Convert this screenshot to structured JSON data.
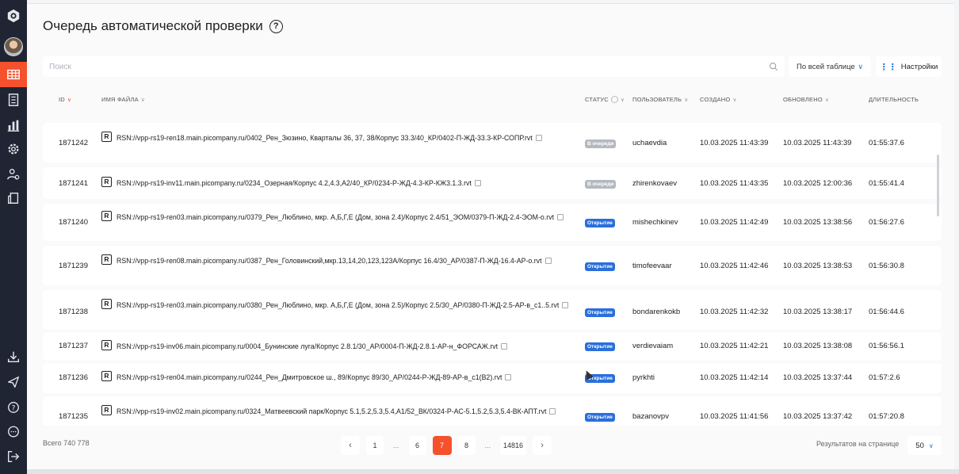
{
  "page": {
    "title": "Очередь автоматической проверки",
    "help_icon": "?"
  },
  "toolbar": {
    "search_placeholder": "Поиск",
    "scope_select": "По всей таблице",
    "settings_label": "Настройки"
  },
  "table": {
    "headers": {
      "id": "ID",
      "file": "Имя файла",
      "status": "Статус",
      "user": "Пользователь",
      "created": "Создано",
      "updated": "Обновлено",
      "duration": "Длительность"
    },
    "rows": [
      {
        "id": "1871242",
        "file": "RSN://vpp-rs19-ren18.main.picompany.ru/0402_Рен_Зюзино, Кварталы 36, 37, 38/Корпус 33.3/40_КР/0402-П-ЖД-33.3-КР-СОПР.rvt",
        "status": "В очереди",
        "status_type": "queue",
        "user": "uchaevdia",
        "created": "10.03.2025 11:43:39",
        "updated": "10.03.2025 11:43:39",
        "duration": "01:55:37.6"
      },
      {
        "id": "1871241",
        "file": "RSN://vpp-rs19-inv11.main.picompany.ru/0234_Озерная/Корпус 4.2,4.3,A2/40_КР/0234-Р-ЖД-4.3-КР-КЖ3.1.3.rvt",
        "status": "В очереди",
        "status_type": "queue",
        "user": "zhirenkovaev",
        "created": "10.03.2025 11:43:35",
        "updated": "10.03.2025 12:00:36",
        "duration": "01:55:41.4"
      },
      {
        "id": "1871240",
        "file": "RSN://vpp-rs19-ren03.main.picompany.ru/0379_Рен_Люблино, мкр. А,Б,Г,Е (Дом, зона 2.4)/Корпус 2.4/51_ЭОМ/0379-П-ЖД-2.4-ЭОМ-о.rvt",
        "status": "Открытие",
        "status_type": "open",
        "user": "mishechkinev",
        "created": "10.03.2025 11:42:49",
        "updated": "10.03.2025 13:38:56",
        "duration": "01:56:27.6"
      },
      {
        "id": "1871239",
        "file": "RSN://vpp-rs19-ren08.main.picompany.ru/0387_Рен_Головинский,мкр.13,14,20,123,123А/Корпус 16.4/30_АР/0387-П-ЖД-16.4-АР-о.rvt",
        "status": "Открытие",
        "status_type": "open",
        "user": "timofeevaar",
        "created": "10.03.2025 11:42:46",
        "updated": "10.03.2025 13:38:53",
        "duration": "01:56:30.8"
      },
      {
        "id": "1871238",
        "file": "RSN://vpp-rs19-ren03.main.picompany.ru/0380_Рен_Люблино, мкр. А,Б,Г,Е (Дом, зона 2.5)/Корпус 2.5/30_АР/0380-П-ЖД-2.5-АР-в_с1..5.rvt",
        "status": "Открытие",
        "status_type": "open",
        "user": "bondarenkokb",
        "created": "10.03.2025 11:42:32",
        "updated": "10.03.2025 13:38:17",
        "duration": "01:56:44.6"
      },
      {
        "id": "1871237",
        "file": "RSN://vpp-rs19-inv06.main.picompany.ru/0004_Бунинские луга/Корпус 2.8.1/30_АР/0004-П-ЖД-2.8.1-АР-н_ФОРСАЖ.rvt",
        "status": "Открытие",
        "status_type": "open",
        "user": "verdievaiam",
        "created": "10.03.2025 11:42:21",
        "updated": "10.03.2025 13:38:08",
        "duration": "01:56:56.1"
      },
      {
        "id": "1871236",
        "file": "RSN://vpp-rs19-ren04.main.picompany.ru/0244_Рен_Дмитровское ш., 89/Корпус 89/30_АР/0244-Р-ЖД-89-АР-в_с1(В2).rvt",
        "status": "Открытие",
        "status_type": "open",
        "user": "pyrkhti",
        "created": "10.03.2025 11:42:14",
        "updated": "10.03.2025 13:37:44",
        "duration": "01:57:2.6"
      },
      {
        "id": "1871235",
        "file": "RSN://vpp-rs19-inv02.main.picompany.ru/0324_Матвеевский парк/Корпус 5.1,5.2,5.3,5.4,A1/52_ВК/0324-Р-АС-5.1,5.2,5.3,5.4-ВК-АПТ.rvt",
        "status": "Открытие",
        "status_type": "open",
        "user": "bazanovpv",
        "created": "10.03.2025 11:41:56",
        "updated": "10.03.2025 13:37:42",
        "duration": "01:57:20.8"
      }
    ]
  },
  "footer": {
    "total": "Всего 740 778",
    "pages": [
      "1",
      "...",
      "6",
      "7",
      "8",
      "...",
      "14816"
    ],
    "current_page": "7",
    "per_page_label": "Результатов на странице",
    "per_page_value": "50"
  },
  "sidebar": {
    "icons": [
      "logo-icon",
      "avatar",
      "table-icon",
      "document-icon",
      "chart-icon",
      "gear-icon",
      "users-icon",
      "layers-icon",
      "download-icon",
      "send-icon",
      "help-icon",
      "chat-icon",
      "logout-icon"
    ]
  },
  "colors": {
    "accent": "#f5512d",
    "primary": "#2a6fdb",
    "sidebar": "#1f2533",
    "queue_badge": "#b4b8c0"
  }
}
